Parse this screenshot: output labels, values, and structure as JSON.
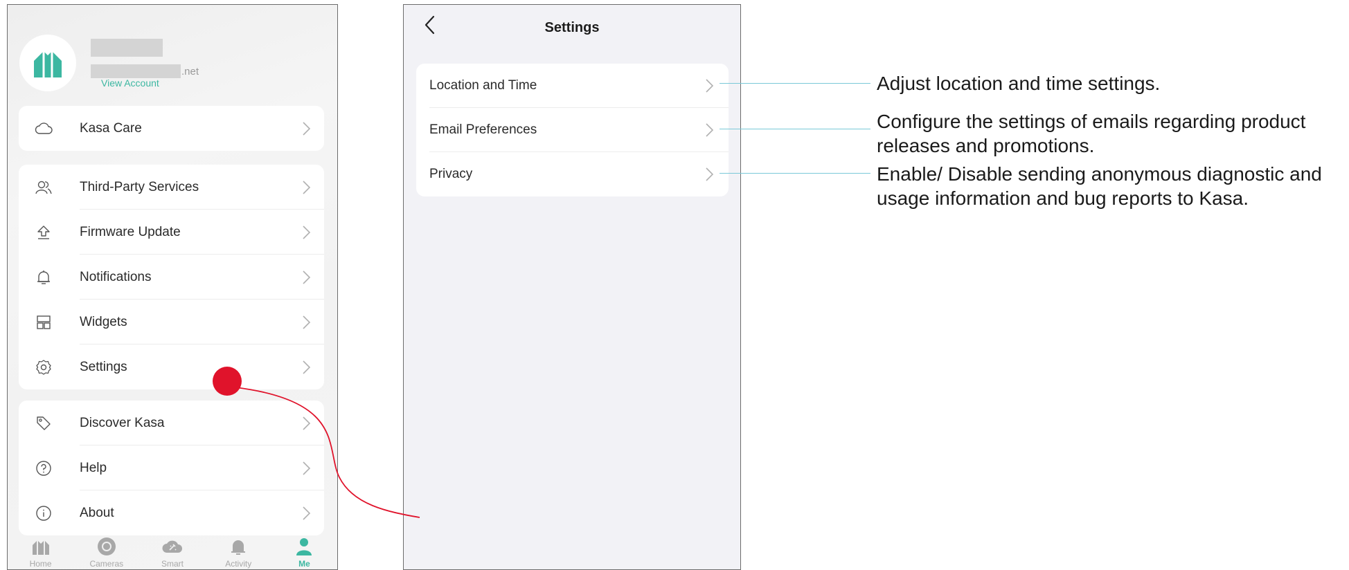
{
  "me_screen": {
    "account": {
      "email_suffix": ".net",
      "view_account_label": "View Account"
    },
    "groups": [
      [
        {
          "label": "Kasa Care",
          "icon": "cloud-icon"
        }
      ],
      [
        {
          "label": "Third-Party Services",
          "icon": "users-icon"
        },
        {
          "label": "Firmware Update",
          "icon": "upload-icon"
        },
        {
          "label": "Notifications",
          "icon": "bell-icon"
        },
        {
          "label": "Widgets",
          "icon": "widgets-icon"
        },
        {
          "label": "Settings",
          "icon": "gear-icon"
        }
      ],
      [
        {
          "label": "Discover Kasa",
          "icon": "tag-icon"
        },
        {
          "label": "Help",
          "icon": "help-icon"
        },
        {
          "label": "About",
          "icon": "info-icon"
        }
      ]
    ],
    "tabbar": [
      {
        "label": "Home",
        "icon": "home-icon",
        "active": false
      },
      {
        "label": "Cameras",
        "icon": "camera-icon",
        "active": false
      },
      {
        "label": "Smart",
        "icon": "smart-icon",
        "active": false
      },
      {
        "label": "Activity",
        "icon": "bell-icon",
        "active": false
      },
      {
        "label": "Me",
        "icon": "person-icon",
        "active": true
      }
    ],
    "colors": {
      "accent": "#3cb7a1",
      "marker": "#e0132b"
    }
  },
  "settings_screen": {
    "title": "Settings",
    "items": [
      {
        "label": "Location and Time"
      },
      {
        "label": "Email Preferences"
      },
      {
        "label": "Privacy"
      }
    ]
  },
  "annotations": [
    {
      "lines": [
        "Adjust location and time settings."
      ]
    },
    {
      "lines": [
        "Configure the settings of emails regarding product",
        "releases and promotions."
      ]
    },
    {
      "lines": [
        "Enable/ Disable sending anonymous diagnostic and",
        "usage information and bug reports to Kasa."
      ]
    }
  ]
}
